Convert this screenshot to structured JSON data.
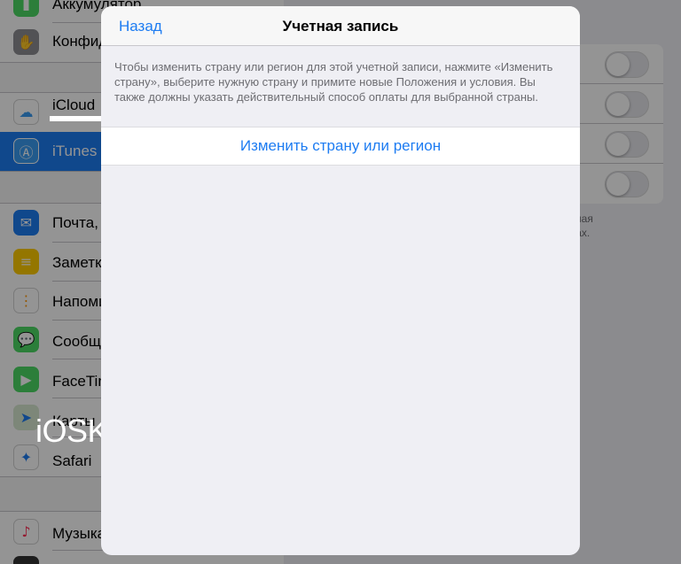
{
  "sidebar": {
    "items": [
      {
        "label": "Аккумулятор",
        "icon": "battery-icon",
        "color": "#4cd964"
      },
      {
        "label": "Конфид",
        "icon": "hand-icon",
        "color": "#8e8e93"
      },
      {
        "label": "iCloud",
        "icon": "cloud-icon",
        "color": "#ffffff"
      },
      {
        "label": "iTunes",
        "icon": "app-store-icon",
        "color": "#1d7cf2"
      },
      {
        "label": "Почта,",
        "icon": "mail-icon",
        "color": "#1d7cf2"
      },
      {
        "label": "Заметк",
        "icon": "notes-icon",
        "color": "#ffcc00"
      },
      {
        "label": "Напоми",
        "icon": "reminders-icon",
        "color": "#ffffff"
      },
      {
        "label": "Сообщ",
        "icon": "messages-icon",
        "color": "#4cd964"
      },
      {
        "label": "FaceTim",
        "icon": "facetime-icon",
        "color": "#4cd964"
      },
      {
        "label": "Карты",
        "icon": "maps-icon",
        "color": "#d8e8d0"
      },
      {
        "label": "Safari",
        "icon": "safari-icon",
        "color": "#1d7cf2"
      },
      {
        "label": "Музыка",
        "icon": "music-icon",
        "color": "#ffffff"
      }
    ]
  },
  "detail": {
    "footer_lines": [
      "очая",
      "вах."
    ]
  },
  "watermark": "iOSKA.ru",
  "modal": {
    "back_label": "Назад",
    "title": "Учетная запись",
    "description": "Чтобы изменить страну или регион для этой учетной записи, нажмите «Изменить страну», выберите нужную страну и примите новые Положения и условия. Вы также должны указать действительный способ оплаты для выбранной страны.",
    "action_label": "Изменить страну или регион"
  },
  "colors": {
    "accent": "#1d7cf2",
    "dim_overlay": "rgba(0,0,0,0.42)"
  }
}
